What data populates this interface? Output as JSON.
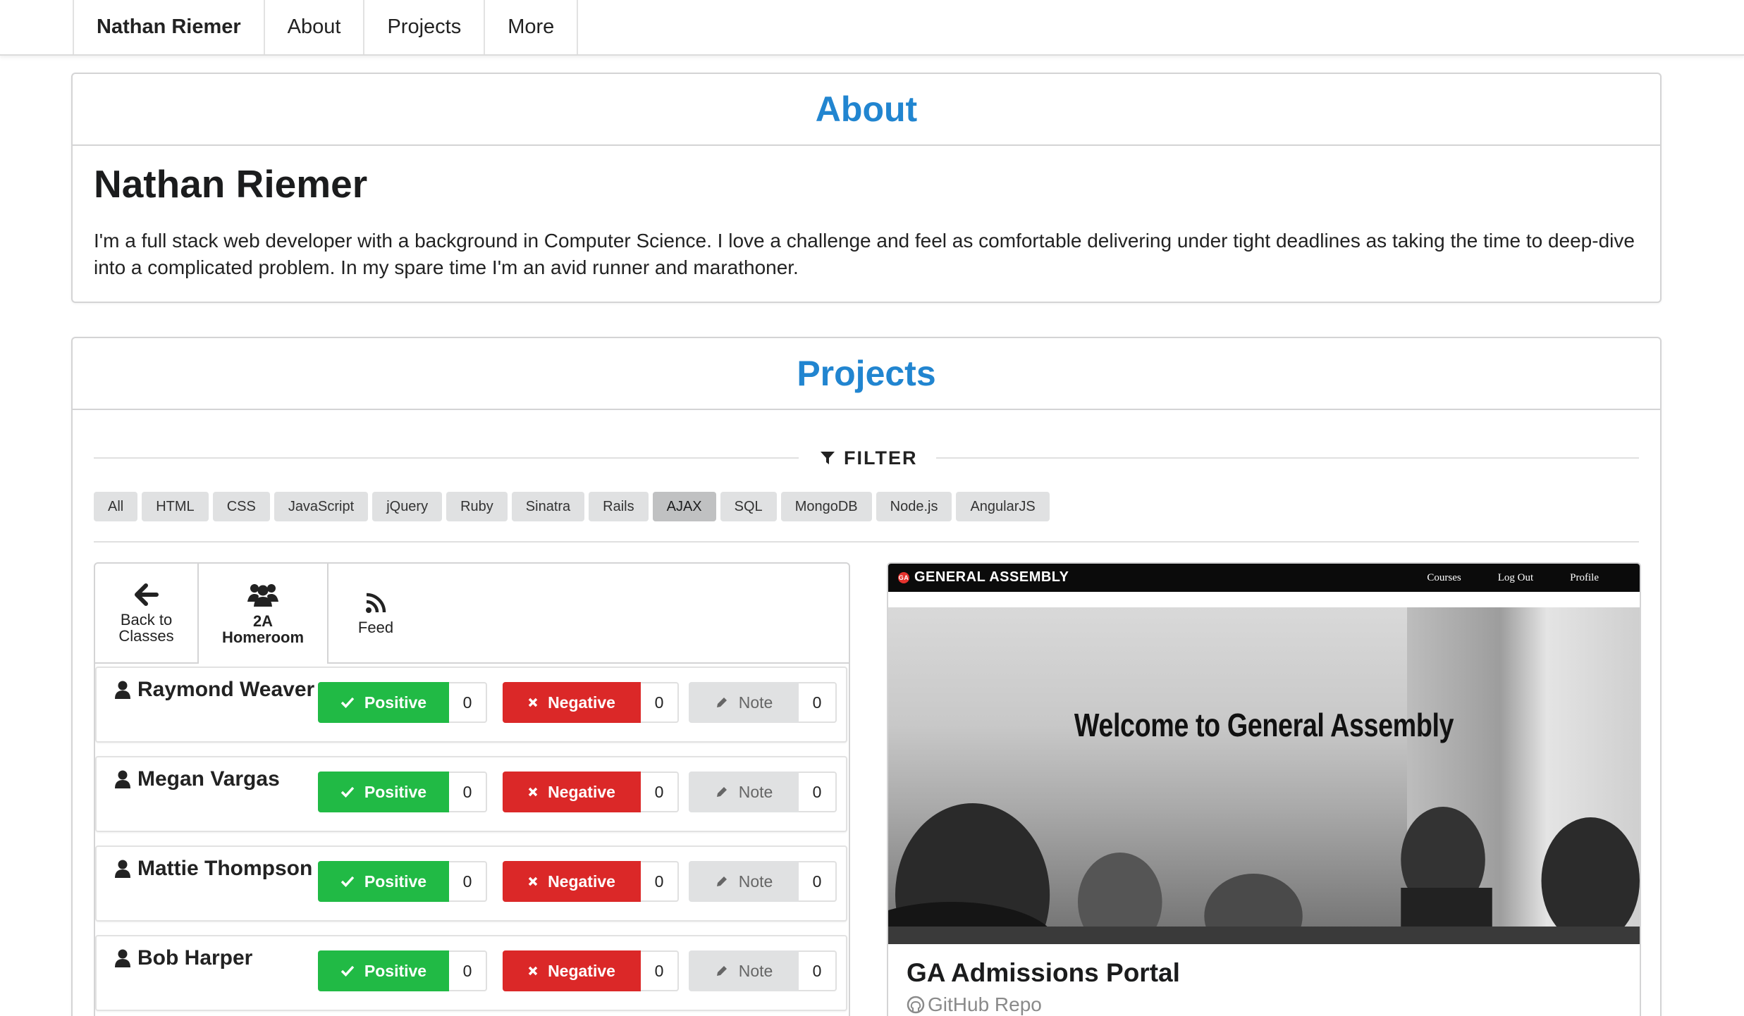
{
  "nav": {
    "brand": "Nathan Riemer",
    "items": [
      "About",
      "Projects",
      "More"
    ]
  },
  "about": {
    "heading": "About",
    "name": "Nathan Riemer",
    "bio": "I'm a full stack web developer with a background in Computer Science. I love a challenge and feel as comfortable delivering under tight deadlines as taking the time to deep-dive into a complicated problem. In my spare time I'm an avid runner and marathoner."
  },
  "projects": {
    "heading": "Projects",
    "filter_label": "FILTER",
    "tags": [
      "All",
      "HTML",
      "CSS",
      "JavaScript",
      "jQuery",
      "Ruby",
      "Sinatra",
      "Rails",
      "AJAX",
      "SQL",
      "MongoDB",
      "Node.js",
      "AngularJS"
    ],
    "active_tag": "AJAX"
  },
  "app_preview": {
    "tabs": [
      {
        "line1": "Back to",
        "line2": "Classes",
        "icon": "arrow-left-icon"
      },
      {
        "line1": "2A",
        "line2": "Homeroom",
        "icon": "users-icon"
      },
      {
        "line1": "Feed",
        "line2": "",
        "icon": "rss-icon"
      }
    ],
    "button_labels": {
      "positive": "Positive",
      "negative": "Negative",
      "note": "Note"
    },
    "students": [
      {
        "name": "Raymond Weaver",
        "positive": "0",
        "negative": "0",
        "note": "0"
      },
      {
        "name": "Megan Vargas",
        "positive": "0",
        "negative": "0",
        "note": "0"
      },
      {
        "name": "Mattie Thompson",
        "positive": "0",
        "negative": "0",
        "note": "0"
      },
      {
        "name": "Bob Harper",
        "positive": "0",
        "negative": "0",
        "note": "0"
      }
    ]
  },
  "project_card": {
    "brand": "GENERAL ASSEMBLY",
    "brand_mark": "GA",
    "links": [
      "Courses",
      "Log Out",
      "Profile"
    ],
    "hero_text": "Welcome to General Assembly",
    "title": "GA Admissions Portal",
    "repo_link": "GitHub Repo"
  },
  "colors": {
    "accent": "#2185d0",
    "positive": "#21ba45",
    "negative": "#db2828",
    "neutral": "#e0e1e2"
  }
}
